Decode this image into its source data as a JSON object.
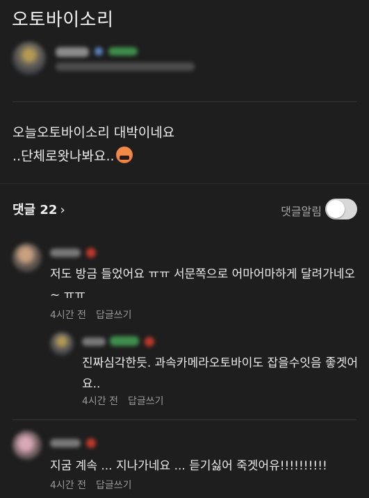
{
  "header": {
    "title": "오토바이소리"
  },
  "post": {
    "lines": [
      "오늘오토바이소리 대박이네요",
      "..단체로왓나봐요.."
    ],
    "emoji": "angry-face-emoji"
  },
  "comments_bar": {
    "label": "댓글 22",
    "chevron": "›",
    "notify_label": "댓글알림",
    "notify_on": false
  },
  "comments": [
    {
      "text": "저도 방금 들었어요 ㅠㅠ 서문쪽으로 어마어마하게 달려가네오~ ㅠㅠ",
      "time": "4시간 전",
      "reply_label": "답글쓰기"
    },
    {
      "text": "진짜심각한듯. 과속카메라오토바이도 잡을수잇음 좋겟어요..",
      "time": "4시간 전",
      "reply_label": "답글쓰기"
    },
    {
      "text": "지굼 계속 ... 지나가네요 ... 듣기싫어 죽겟어유!!!!!!!!!!",
      "time": "4시간 전",
      "reply_label": "답글쓰기"
    }
  ],
  "colors": {
    "background": "#1e1e1e",
    "text": "#ececec",
    "muted": "#9a9a9a",
    "divider": "#353535"
  }
}
